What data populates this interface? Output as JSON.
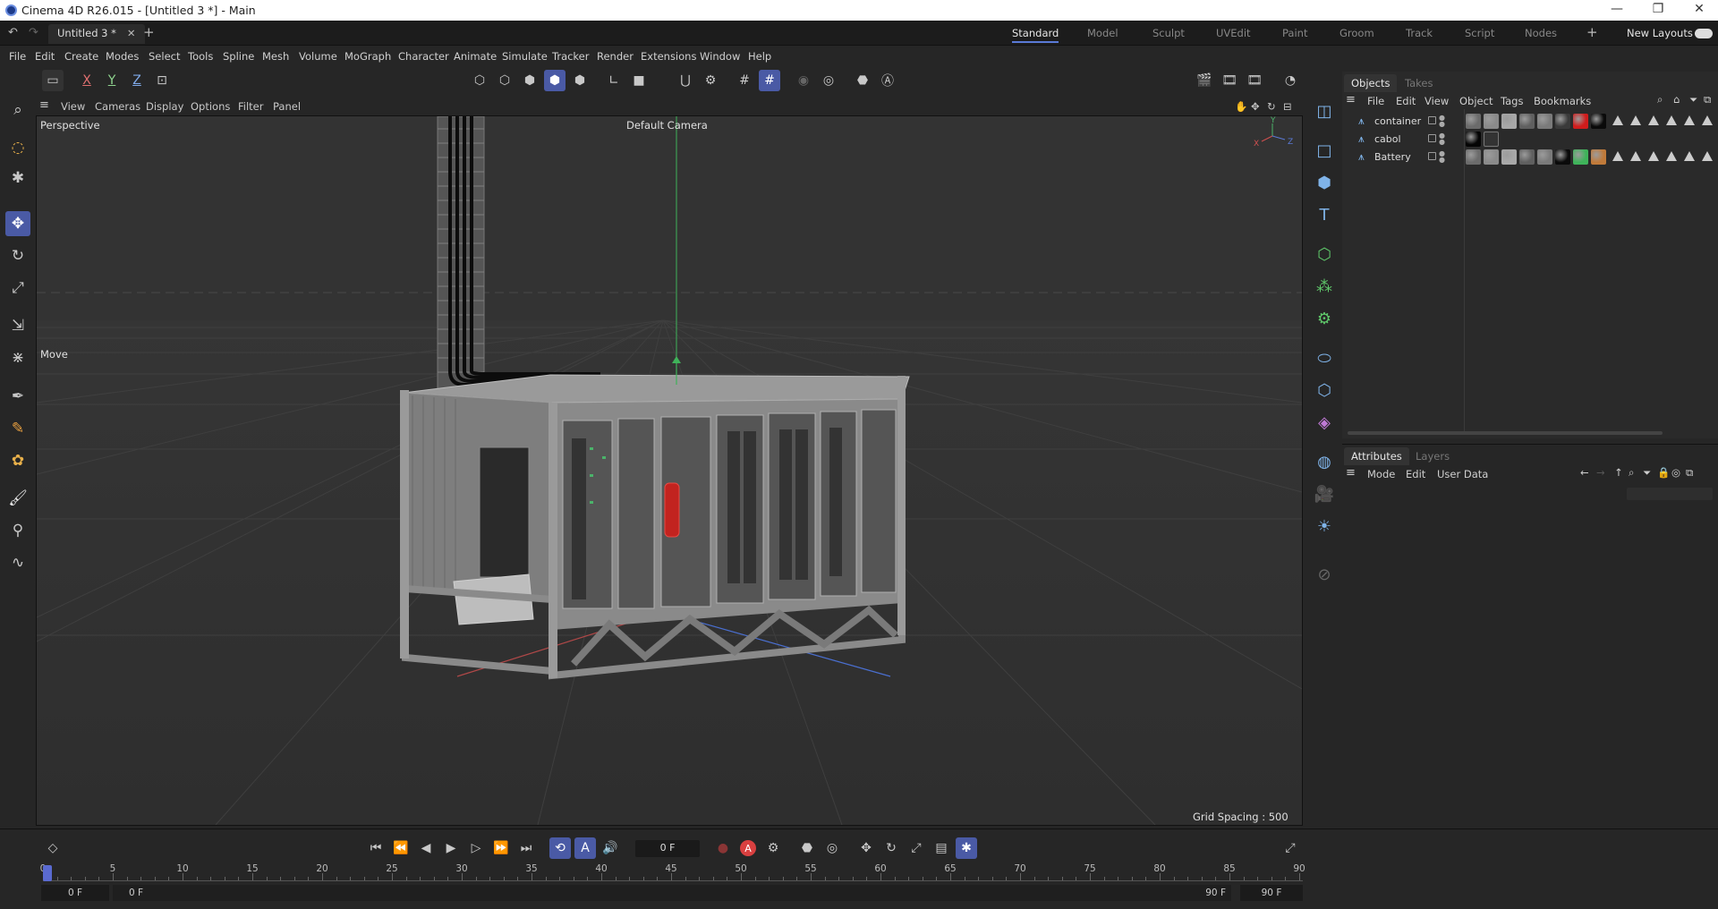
{
  "window": {
    "title": "Cinema 4D R26.015 - [Untitled 3 *] - Main",
    "minimize": "—",
    "maximize": "❐",
    "close": "✕"
  },
  "tabs": {
    "document": "Untitled 3 *",
    "layouts": [
      "Standard",
      "Model",
      "Sculpt",
      "UVEdit",
      "Paint",
      "Groom",
      "Track",
      "Script",
      "Nodes"
    ],
    "active_layout": "Standard",
    "new_layouts": "New Layouts"
  },
  "menu": [
    "File",
    "Edit",
    "Create",
    "Modes",
    "Select",
    "Tools",
    "Spline",
    "Mesh",
    "Volume",
    "MoGraph",
    "Character",
    "Animate",
    "Simulate",
    "Tracker",
    "Render",
    "Extensions",
    "Window",
    "Help"
  ],
  "axis_toggles": {
    "x": "X",
    "y": "Y",
    "z": "Z"
  },
  "viewport": {
    "menu": [
      "View",
      "Cameras",
      "Display",
      "Options",
      "Filter",
      "Panel"
    ],
    "projection": "Perspective",
    "camera": "Default Camera",
    "tool_label": "Move",
    "grid_spacing": "Grid Spacing : 500 cm",
    "axis_gizmo": {
      "x": "X",
      "y": "Y",
      "z": "Z"
    }
  },
  "objects_panel": {
    "tabs": [
      "Objects",
      "Takes"
    ],
    "menu": [
      "File",
      "Edit",
      "View",
      "Object",
      "Tags",
      "Bookmarks"
    ],
    "objects": [
      {
        "name": "container",
        "materials": [
          "#6b6b6b",
          "#8a8a8a",
          "#a8a8a8",
          "#5f5f5f",
          "#7a7a7a",
          "#3a3a3a",
          "#d01c1c",
          "#0a0a0a"
        ],
        "tag_count": 6
      },
      {
        "name": "cabol",
        "materials": [
          "#050505"
        ],
        "tag_count": 0
      },
      {
        "name": "Battery",
        "materials": [
          "#6b6b6b",
          "#8a8a8a",
          "#a8a8a8",
          "#5f5f5f",
          "#7a7a7a",
          "#0a0a0a",
          "#3fb35a",
          "#c07a3a"
        ],
        "tag_count": 6
      }
    ]
  },
  "attributes_panel": {
    "tabs": [
      "Attributes",
      "Layers"
    ],
    "menu": [
      "Mode",
      "Edit",
      "User Data"
    ]
  },
  "timeline": {
    "current_frame": "0 F",
    "ruler_labels": [
      "0",
      "5",
      "10",
      "15",
      "20",
      "25",
      "30",
      "35",
      "40",
      "45",
      "50",
      "55",
      "60",
      "65",
      "70",
      "75",
      "80",
      "85",
      "90"
    ],
    "start": "0 F",
    "range_start": "0 F",
    "range_end": "90 F",
    "end": "90 F"
  },
  "colors": {
    "accent": "#4a5aa5",
    "record": "#d94040",
    "icon_blue": "#7fb3e8",
    "icon_green": "#5fc86a"
  }
}
